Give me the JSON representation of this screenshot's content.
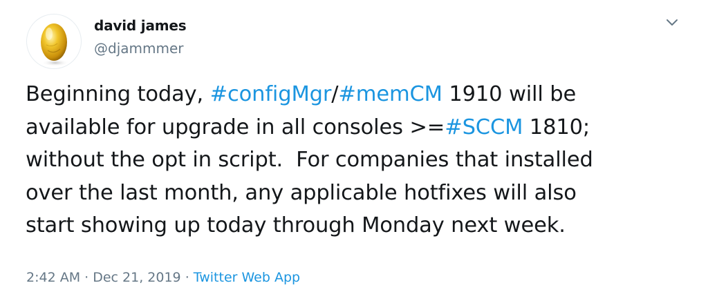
{
  "author": {
    "display_name": "david james",
    "handle": "@djammmer",
    "avatar_icon": "golden-egg-icon"
  },
  "menu": {
    "caret_icon": "chevron-down-icon"
  },
  "tweet": {
    "line1": {
      "text1": "Beginning today, ",
      "hashtag1": "#configMgr",
      "text2": "/",
      "hashtag2": "#memCM",
      "text3": " 1910 will be"
    },
    "line2": {
      "text1": "available for upgrade in all consoles >=",
      "hashtag1": "#SCCM",
      "text2": " 1810;"
    },
    "line3": "without the opt in script.  For companies that installed",
    "line4": "over the last month, any applicable hotfixes will also",
    "line5": "start showing up today through Monday next week."
  },
  "meta": {
    "time": "2:42 AM",
    "separator1": " · ",
    "date": "Dec 21, 2019",
    "separator2": " · ",
    "source": "Twitter Web App"
  },
  "colors": {
    "link": "#1b95e0",
    "secondary": "#657786",
    "text": "#14171a"
  }
}
